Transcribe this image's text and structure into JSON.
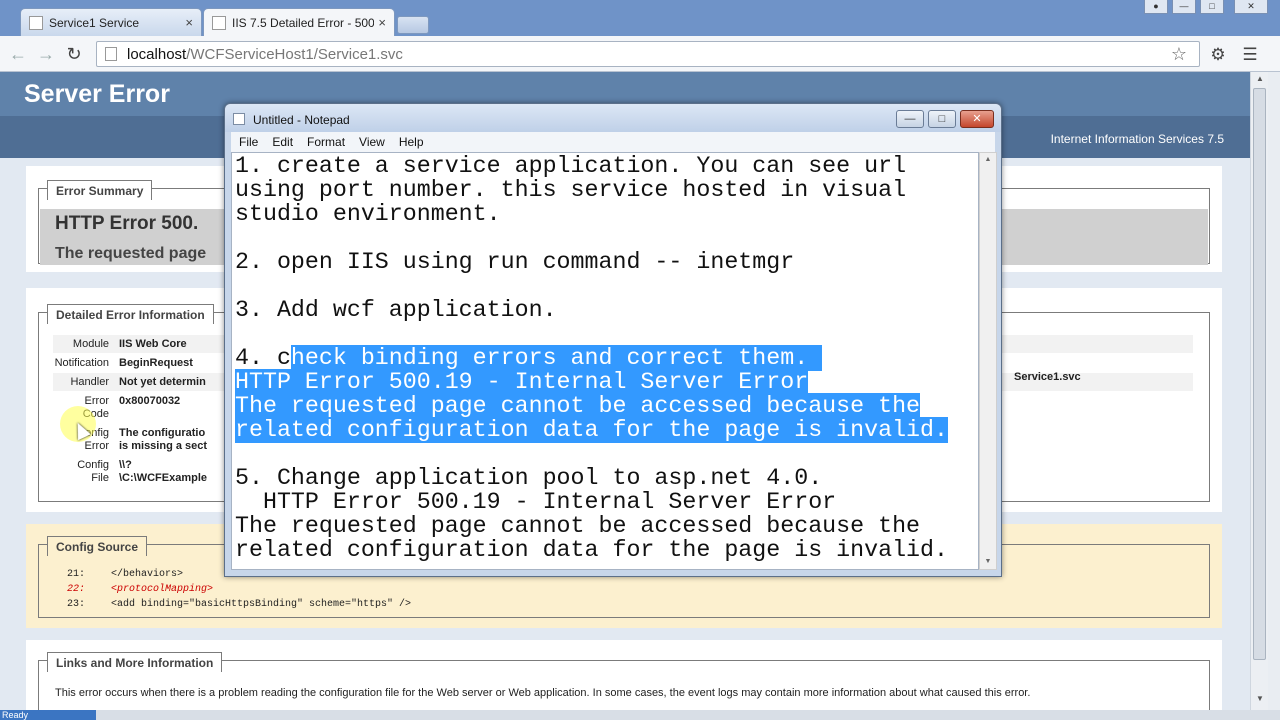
{
  "browser": {
    "tabs": [
      {
        "label": "Service1 Service",
        "close": "×"
      },
      {
        "label": "IIS 7.5 Detailed Error - 500",
        "close": "×"
      }
    ],
    "url_host": "localhost",
    "url_path": "/WCFServiceHost1/Service1.svc",
    "status": "Ready"
  },
  "page": {
    "header_title": "Server Error",
    "iis_name": "Internet Information Services 7.5",
    "summary": {
      "legend": "Error Summary",
      "title": "HTTP Error 500.",
      "subtitle": "The requested page"
    },
    "detail": {
      "legend": "Detailed Error Information",
      "rows": [
        {
          "label": "Module",
          "value": "IIS Web Core"
        },
        {
          "label": "Notification",
          "value": "BeginRequest"
        },
        {
          "label": "Handler",
          "value": "Not yet determin"
        },
        {
          "label": "Error",
          "label2": "Code",
          "value": "0x80070032"
        },
        {
          "label": "Config",
          "label2": "Error",
          "value": "The configuratio",
          "value2": "is missing a sect"
        },
        {
          "label": "Config",
          "label2": "File",
          "value": "\\\\?",
          "value2": "\\C:\\WCFExample"
        }
      ],
      "side_url": "Service1.svc"
    },
    "config_source": {
      "legend": "Config Source",
      "lines": [
        {
          "num": "21:",
          "text": "    </behaviors>"
        },
        {
          "num": "22:",
          "text": "    <protocolMapping>"
        },
        {
          "num": "23:",
          "text": "        <add binding=\"basicHttpsBinding\" scheme=\"https\" />"
        }
      ]
    },
    "links": {
      "legend": "Links and More Information",
      "text": "This error occurs when there is a problem reading the configuration file for the Web server or Web application. In some cases, the event logs may contain more information about what caused this error."
    }
  },
  "notepad": {
    "title": "Untitled - Notepad",
    "menu": [
      "File",
      "Edit",
      "Format",
      "View",
      "Help"
    ],
    "lines": [
      "1. create a service application. You can see url",
      "using port number. this service hosted in visual",
      "studio environment.",
      "",
      "2. open IIS using run command -- inetmgr",
      "",
      "3. Add wcf application.",
      "",
      "4. c",
      "heck binding errors and correct them. ",
      "HTTP Error 500.19 - Internal Server Error",
      "The requested page cannot be accessed because the",
      "related configuration data for the page is invalid.",
      "",
      "5. Change application pool to asp.net 4.0.",
      "  HTTP Error 500.19 - Internal Server Error",
      "The requested page cannot be accessed because the",
      "related configuration data for the page is invalid."
    ]
  }
}
